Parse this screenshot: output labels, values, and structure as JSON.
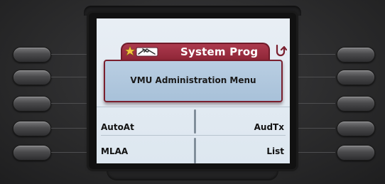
{
  "header": {
    "title": "System Prog",
    "icon": "star-tools-icon",
    "back_icon": "back-arrow-icon",
    "tab_color": "#9b2e41"
  },
  "menu": {
    "title": "VMU Administration Menu"
  },
  "softkeys": {
    "left": [
      "AutoAt",
      "MLAA"
    ],
    "right": [
      "AudTx",
      "List"
    ]
  },
  "side_buttons": {
    "left_count": 5,
    "right_count": 5
  }
}
